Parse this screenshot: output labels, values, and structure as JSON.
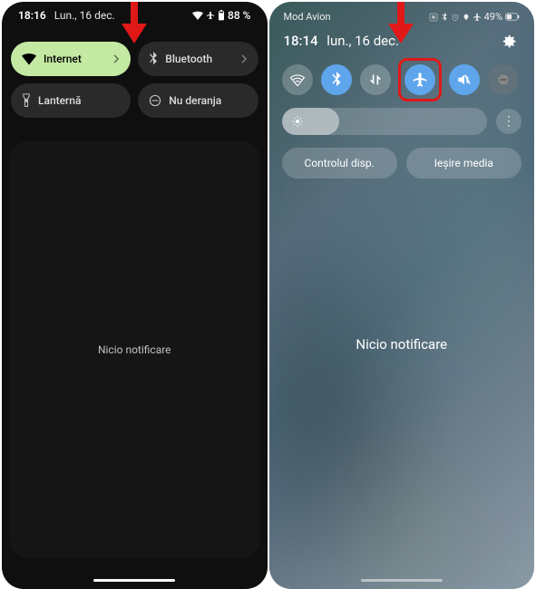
{
  "left": {
    "status": {
      "time": "18:16",
      "date": "Lun., 16 dec.",
      "battery": "88 %"
    },
    "tiles": {
      "internet": "Internet",
      "bluetooth": "Bluetooth",
      "flashlight": "Lanternă",
      "dnd": "Nu deranja"
    },
    "no_notif": "Nicio notificare"
  },
  "right": {
    "mode_label": "Mod Avion",
    "status": {
      "battery": "49%"
    },
    "time_row": {
      "time": "18:14",
      "date": "lun., 16 dec."
    },
    "pills": {
      "device_ctrl": "Controlul disp.",
      "media_out": "Ieșire media"
    },
    "no_notif": "Nicio notificare"
  },
  "colors": {
    "annotation_arrow": "#e01818",
    "tile_on": "#c3e9a2",
    "qs_on": "#5fa5ec"
  }
}
